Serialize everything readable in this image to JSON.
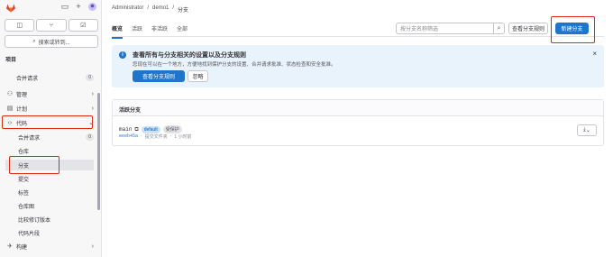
{
  "sidebar": {
    "top_icons": [
      "sidebar-toggle-icon",
      "plus-icon",
      "avatar"
    ],
    "buttons": [
      "issues",
      "merge-requests",
      "todos"
    ],
    "search_label": "搜索或转到...",
    "section": "项目",
    "items": [
      {
        "label": "合并请求",
        "count": "0"
      },
      {
        "label": "管理",
        "chev": "›"
      },
      {
        "label": "计划",
        "chev": "›"
      },
      {
        "label": "代码",
        "chev": "⌄"
      },
      {
        "label": "合并请求",
        "count": "0"
      },
      {
        "label": "仓库"
      },
      {
        "label": "分支"
      },
      {
        "label": "提交"
      },
      {
        "label": "标签"
      },
      {
        "label": "仓库图"
      },
      {
        "label": "比较修订版本"
      },
      {
        "label": "代码片段"
      },
      {
        "label": "构建",
        "chev": "›"
      }
    ]
  },
  "breadcrumb": {
    "items": [
      "Administrator",
      "demo1"
    ],
    "sep": "/",
    "current": "分支"
  },
  "tabs": [
    "概览",
    "活跃",
    "非活跃",
    "全部"
  ],
  "filter": {
    "placeholder": "按分支名称筛选"
  },
  "buttons": {
    "view_rules": "查看分支规则",
    "new_branch": "新建分支"
  },
  "alert": {
    "title": "查看所有与分支相关的设置以及分支规则",
    "description": "您现在可以在一个地方，方便地找到保护分支的设置、合并请求批准、状态检查和安全批准。",
    "primary": "查看分支规则",
    "secondary": "忽略",
    "close": "×"
  },
  "panel": {
    "title": "活跃分支",
    "branch": {
      "name": "main",
      "default_badge": "default",
      "protected_badge": "受保护",
      "sha": "eeeb45a",
      "sep": "·",
      "message": "提交文件夹",
      "time": "1 小时前"
    }
  },
  "colors": {
    "accent": "#1f75cb",
    "highlight": "#dd2b0e"
  }
}
